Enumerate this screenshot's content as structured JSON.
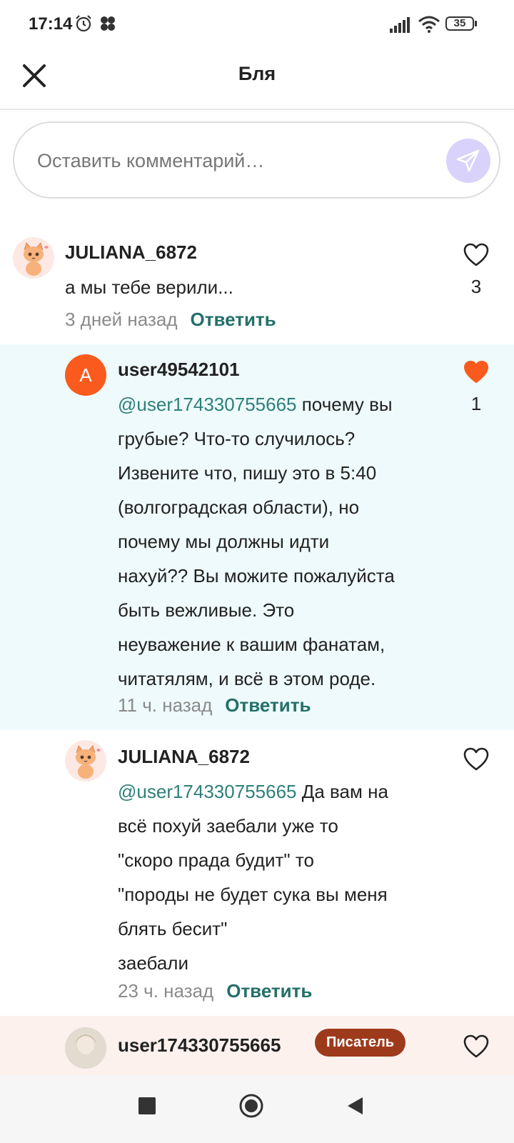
{
  "status_bar": {
    "time": "17:14",
    "battery": "35"
  },
  "header": {
    "title": "Бля"
  },
  "comment_input": {
    "placeholder": "Оставить комментарий…"
  },
  "comments": [
    {
      "username": "JULIANA_6872",
      "text_plain": "а мы тебе верили...",
      "time_ago": "3 дней назад",
      "reply_label": "Ответить",
      "like_count": "3"
    },
    {
      "avatar_letter": "A",
      "username": "user49542101",
      "mention": "@user174330755665",
      "text_rest": " почему вы\nгрубые? Что-то случилось?\nИзвените что, пишу это в 5:40\n(волгоградская области), но\nпочему мы должны идти\nнахуй?? Вы можите пожалуйста\nбыть вежливые. Это\nнеуважение к вашим фанатам,\nчитатялям, и всё в этом роде.",
      "time_ago": "11 ч. назад",
      "reply_label": "Ответить",
      "like_count": "1"
    },
    {
      "username": "JULIANA_6872",
      "mention": "@user174330755665",
      "text_rest": " Да вам на\nвсё похуй заебали уже то\n\"скоро прада будит\" то\n\"породы не будет сука вы меня\nблять бесит\"\nзаебали",
      "time_ago": "23 ч. назад",
      "reply_label": "Ответить"
    },
    {
      "username": "user174330755665",
      "badge": "Писатель"
    }
  ],
  "colors": {
    "accent_teal": "#24706a",
    "liked_orange": "#fb5a1e",
    "highlight_bg": "#eefafb",
    "writer_row_bg": "#fdf1ee",
    "badge_bg": "#9e3a1c",
    "send_bg": "#d9d2fb"
  }
}
